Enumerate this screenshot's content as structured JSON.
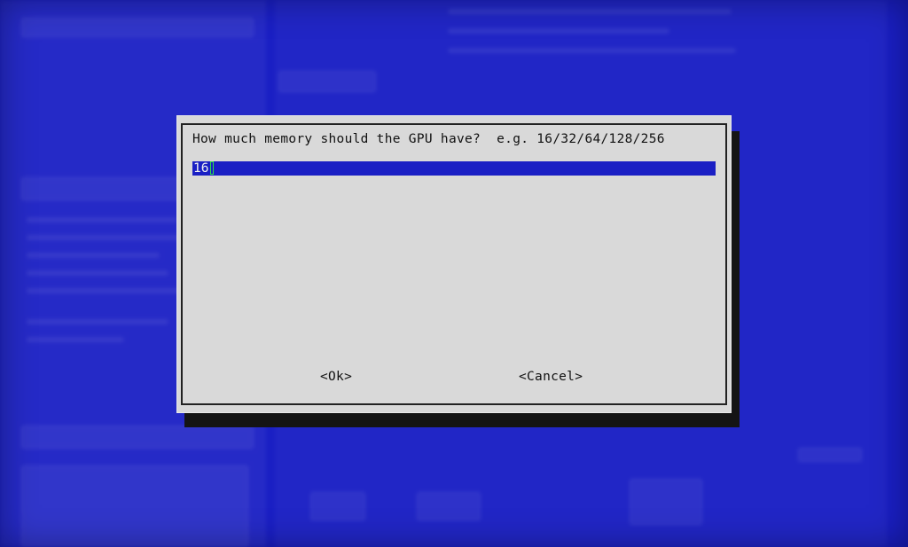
{
  "dialog": {
    "prompt": "How much memory should the GPU have?  e.g. 16/32/64/128/256",
    "input_value": "16",
    "ok_label": "<Ok>",
    "cancel_label": "<Cancel>"
  },
  "colors": {
    "background": "#1a1fc4",
    "dialog": "#d9d9d9",
    "input_bar": "#1a1fc4",
    "caret": "#2ee04a"
  }
}
